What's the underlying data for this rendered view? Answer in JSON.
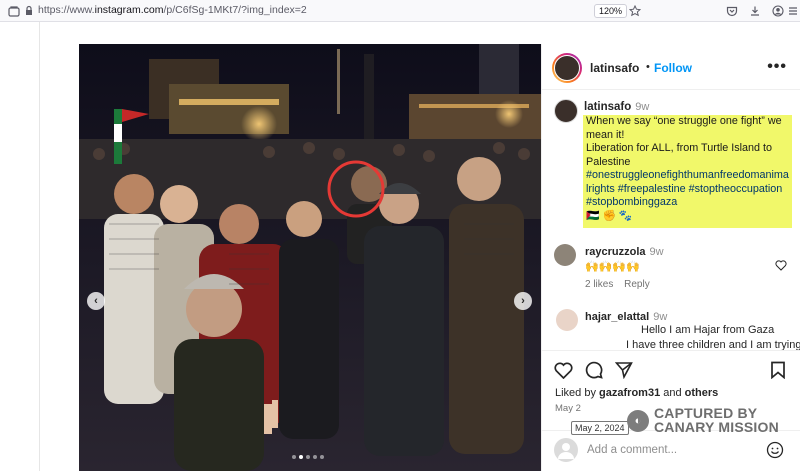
{
  "browser": {
    "url_prefix": "https://www.",
    "url_domain": "instagram.com",
    "url_path": "/p/C6fSg-1MKt7/?img_index=2",
    "zoom": "120%",
    "icons": [
      "page-info-icon",
      "bookmark-star-icon",
      "pocket-icon",
      "download-icon",
      "account-icon",
      "extensions-icon",
      "menu-icon"
    ]
  },
  "post": {
    "carousel": {
      "dots": 5,
      "active_index": 1
    },
    "author": {
      "handle": "latinsafo",
      "follow_label": "Follow",
      "separator": "•"
    },
    "caption": {
      "handle": "latinsafo",
      "time": "9w",
      "line1": "When we say “one struggle one fight” we mean it!",
      "line2": "Liberation for ALL, from Turtle Island to Palestine",
      "hashtags": "#onestruggleonefighthumanfreedomanimalrights #freepalestine #stoptheoccupation #stopbombinggaza",
      "emoji": "🇵🇸 ✊ 🐾"
    },
    "comments": [
      {
        "handle": "raycruzzola",
        "time": "9w",
        "text": "🙌🙌🙌🙌",
        "likes": "2 likes",
        "reply_label": "Reply"
      },
      {
        "handle": "hajar_elattal",
        "time": "9w",
        "line1": "Hello I am Hajar from Gaza",
        "line2": "I have three children and I am trying"
      }
    ],
    "likes": {
      "prefix": "Liked by",
      "user": "gazafrom31",
      "conjunction": "and",
      "rest": "others"
    },
    "date": "May 2",
    "add_comment_placeholder": "Add a comment..."
  },
  "watermark": {
    "date": "May 2, 2024",
    "line1": "CAPTURED BY",
    "line2": "CANARY MISSION"
  },
  "colors": {
    "highlight": "#f1f86a",
    "link": "#0095f6",
    "hashtag": "#00376b"
  }
}
